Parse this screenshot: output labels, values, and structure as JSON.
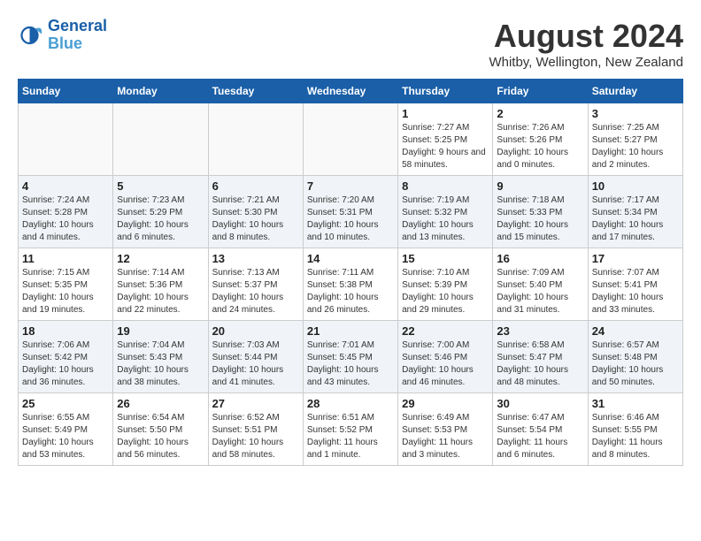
{
  "header": {
    "logo_line1": "General",
    "logo_line2": "Blue",
    "title": "August 2024",
    "location": "Whitby, Wellington, New Zealand"
  },
  "weekdays": [
    "Sunday",
    "Monday",
    "Tuesday",
    "Wednesday",
    "Thursday",
    "Friday",
    "Saturday"
  ],
  "weeks": [
    [
      {
        "day": "",
        "sunrise": "",
        "sunset": "",
        "daylight": ""
      },
      {
        "day": "",
        "sunrise": "",
        "sunset": "",
        "daylight": ""
      },
      {
        "day": "",
        "sunrise": "",
        "sunset": "",
        "daylight": ""
      },
      {
        "day": "",
        "sunrise": "",
        "sunset": "",
        "daylight": ""
      },
      {
        "day": "1",
        "sunrise": "Sunrise: 7:27 AM",
        "sunset": "Sunset: 5:25 PM",
        "daylight": "Daylight: 9 hours and 58 minutes."
      },
      {
        "day": "2",
        "sunrise": "Sunrise: 7:26 AM",
        "sunset": "Sunset: 5:26 PM",
        "daylight": "Daylight: 10 hours and 0 minutes."
      },
      {
        "day": "3",
        "sunrise": "Sunrise: 7:25 AM",
        "sunset": "Sunset: 5:27 PM",
        "daylight": "Daylight: 10 hours and 2 minutes."
      }
    ],
    [
      {
        "day": "4",
        "sunrise": "Sunrise: 7:24 AM",
        "sunset": "Sunset: 5:28 PM",
        "daylight": "Daylight: 10 hours and 4 minutes."
      },
      {
        "day": "5",
        "sunrise": "Sunrise: 7:23 AM",
        "sunset": "Sunset: 5:29 PM",
        "daylight": "Daylight: 10 hours and 6 minutes."
      },
      {
        "day": "6",
        "sunrise": "Sunrise: 7:21 AM",
        "sunset": "Sunset: 5:30 PM",
        "daylight": "Daylight: 10 hours and 8 minutes."
      },
      {
        "day": "7",
        "sunrise": "Sunrise: 7:20 AM",
        "sunset": "Sunset: 5:31 PM",
        "daylight": "Daylight: 10 hours and 10 minutes."
      },
      {
        "day": "8",
        "sunrise": "Sunrise: 7:19 AM",
        "sunset": "Sunset: 5:32 PM",
        "daylight": "Daylight: 10 hours and 13 minutes."
      },
      {
        "day": "9",
        "sunrise": "Sunrise: 7:18 AM",
        "sunset": "Sunset: 5:33 PM",
        "daylight": "Daylight: 10 hours and 15 minutes."
      },
      {
        "day": "10",
        "sunrise": "Sunrise: 7:17 AM",
        "sunset": "Sunset: 5:34 PM",
        "daylight": "Daylight: 10 hours and 17 minutes."
      }
    ],
    [
      {
        "day": "11",
        "sunrise": "Sunrise: 7:15 AM",
        "sunset": "Sunset: 5:35 PM",
        "daylight": "Daylight: 10 hours and 19 minutes."
      },
      {
        "day": "12",
        "sunrise": "Sunrise: 7:14 AM",
        "sunset": "Sunset: 5:36 PM",
        "daylight": "Daylight: 10 hours and 22 minutes."
      },
      {
        "day": "13",
        "sunrise": "Sunrise: 7:13 AM",
        "sunset": "Sunset: 5:37 PM",
        "daylight": "Daylight: 10 hours and 24 minutes."
      },
      {
        "day": "14",
        "sunrise": "Sunrise: 7:11 AM",
        "sunset": "Sunset: 5:38 PM",
        "daylight": "Daylight: 10 hours and 26 minutes."
      },
      {
        "day": "15",
        "sunrise": "Sunrise: 7:10 AM",
        "sunset": "Sunset: 5:39 PM",
        "daylight": "Daylight: 10 hours and 29 minutes."
      },
      {
        "day": "16",
        "sunrise": "Sunrise: 7:09 AM",
        "sunset": "Sunset: 5:40 PM",
        "daylight": "Daylight: 10 hours and 31 minutes."
      },
      {
        "day": "17",
        "sunrise": "Sunrise: 7:07 AM",
        "sunset": "Sunset: 5:41 PM",
        "daylight": "Daylight: 10 hours and 33 minutes."
      }
    ],
    [
      {
        "day": "18",
        "sunrise": "Sunrise: 7:06 AM",
        "sunset": "Sunset: 5:42 PM",
        "daylight": "Daylight: 10 hours and 36 minutes."
      },
      {
        "day": "19",
        "sunrise": "Sunrise: 7:04 AM",
        "sunset": "Sunset: 5:43 PM",
        "daylight": "Daylight: 10 hours and 38 minutes."
      },
      {
        "day": "20",
        "sunrise": "Sunrise: 7:03 AM",
        "sunset": "Sunset: 5:44 PM",
        "daylight": "Daylight: 10 hours and 41 minutes."
      },
      {
        "day": "21",
        "sunrise": "Sunrise: 7:01 AM",
        "sunset": "Sunset: 5:45 PM",
        "daylight": "Daylight: 10 hours and 43 minutes."
      },
      {
        "day": "22",
        "sunrise": "Sunrise: 7:00 AM",
        "sunset": "Sunset: 5:46 PM",
        "daylight": "Daylight: 10 hours and 46 minutes."
      },
      {
        "day": "23",
        "sunrise": "Sunrise: 6:58 AM",
        "sunset": "Sunset: 5:47 PM",
        "daylight": "Daylight: 10 hours and 48 minutes."
      },
      {
        "day": "24",
        "sunrise": "Sunrise: 6:57 AM",
        "sunset": "Sunset: 5:48 PM",
        "daylight": "Daylight: 10 hours and 50 minutes."
      }
    ],
    [
      {
        "day": "25",
        "sunrise": "Sunrise: 6:55 AM",
        "sunset": "Sunset: 5:49 PM",
        "daylight": "Daylight: 10 hours and 53 minutes."
      },
      {
        "day": "26",
        "sunrise": "Sunrise: 6:54 AM",
        "sunset": "Sunset: 5:50 PM",
        "daylight": "Daylight: 10 hours and 56 minutes."
      },
      {
        "day": "27",
        "sunrise": "Sunrise: 6:52 AM",
        "sunset": "Sunset: 5:51 PM",
        "daylight": "Daylight: 10 hours and 58 minutes."
      },
      {
        "day": "28",
        "sunrise": "Sunrise: 6:51 AM",
        "sunset": "Sunset: 5:52 PM",
        "daylight": "Daylight: 11 hours and 1 minute."
      },
      {
        "day": "29",
        "sunrise": "Sunrise: 6:49 AM",
        "sunset": "Sunset: 5:53 PM",
        "daylight": "Daylight: 11 hours and 3 minutes."
      },
      {
        "day": "30",
        "sunrise": "Sunrise: 6:47 AM",
        "sunset": "Sunset: 5:54 PM",
        "daylight": "Daylight: 11 hours and 6 minutes."
      },
      {
        "day": "31",
        "sunrise": "Sunrise: 6:46 AM",
        "sunset": "Sunset: 5:55 PM",
        "daylight": "Daylight: 11 hours and 8 minutes."
      }
    ]
  ]
}
